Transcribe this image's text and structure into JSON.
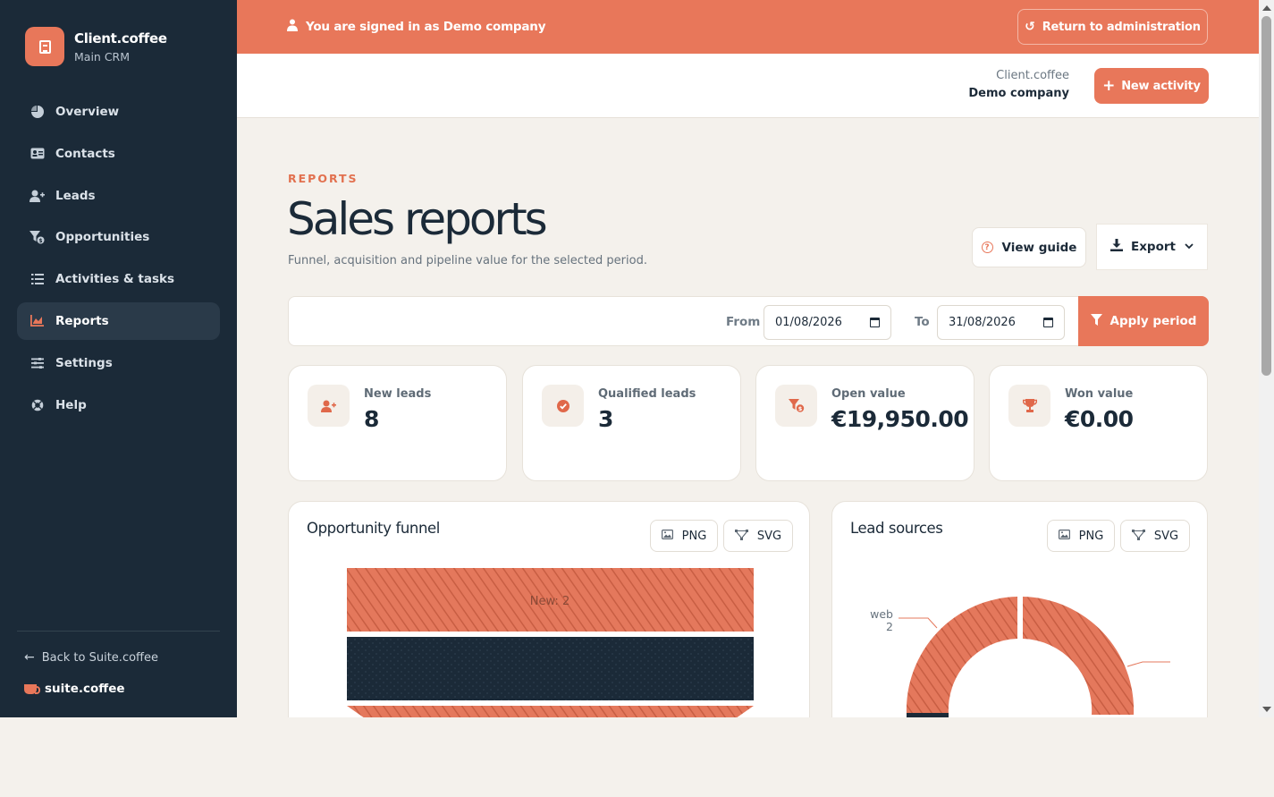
{
  "brand": {
    "name": "Client.coffee",
    "subtitle": "Main CRM"
  },
  "sidebar": {
    "items": [
      {
        "label": "Overview",
        "icon": "pie-chart-icon"
      },
      {
        "label": "Contacts",
        "icon": "address-card-icon"
      },
      {
        "label": "Leads",
        "icon": "user-plus-icon"
      },
      {
        "label": "Opportunities",
        "icon": "funnel-dollar-icon"
      },
      {
        "label": "Activities & tasks",
        "icon": "list-check-icon"
      },
      {
        "label": "Reports",
        "icon": "chart-icon",
        "active": true
      },
      {
        "label": "Settings",
        "icon": "sliders-icon"
      },
      {
        "label": "Help",
        "icon": "lifebuoy-icon"
      }
    ],
    "back_link": "Back to Suite.coffee",
    "suite_name": "suite.coffee"
  },
  "banner": {
    "message": "You are signed in as Demo company",
    "return_label": "Return to administration"
  },
  "topbar": {
    "company_line1": "Client.coffee",
    "company_line2": "Demo company",
    "new_activity_label": "New activity"
  },
  "page": {
    "eyebrow": "REPORTS",
    "title": "Sales reports",
    "subtitle": "Funnel, acquisition and pipeline value for the selected period.",
    "view_guide_label": "View guide",
    "export_label": "Export"
  },
  "filter": {
    "from_label": "From",
    "from_value": "01/08/2026",
    "to_label": "To",
    "to_value": "31/08/2026",
    "apply_label": "Apply period"
  },
  "kpis": [
    {
      "label": "New leads",
      "value": "8",
      "icon": "user-plus-icon"
    },
    {
      "label": "Qualified leads",
      "value": "3",
      "icon": "check-circle-icon"
    },
    {
      "label": "Open value",
      "value": "€19,950.00",
      "icon": "funnel-dollar-icon"
    },
    {
      "label": "Won value",
      "value": "€0.00",
      "icon": "trophy-icon"
    }
  ],
  "charts": {
    "funnel": {
      "title": "Opportunity funnel",
      "png_label": "PNG",
      "svg_label": "SVG"
    },
    "sources": {
      "title": "Lead sources",
      "png_label": "PNG",
      "svg_label": "SVG"
    }
  },
  "chart_data": [
    {
      "type": "funnel",
      "title": "Opportunity funnel",
      "stages": [
        {
          "label": "New",
          "value": 2
        }
      ]
    },
    {
      "type": "pie",
      "title": "Lead sources",
      "slices": [
        {
          "label": "web",
          "value": 2
        }
      ]
    }
  ],
  "colors": {
    "accent": "#e8775a",
    "sidebar": "#1b2a38",
    "background": "#f4f1ec"
  }
}
